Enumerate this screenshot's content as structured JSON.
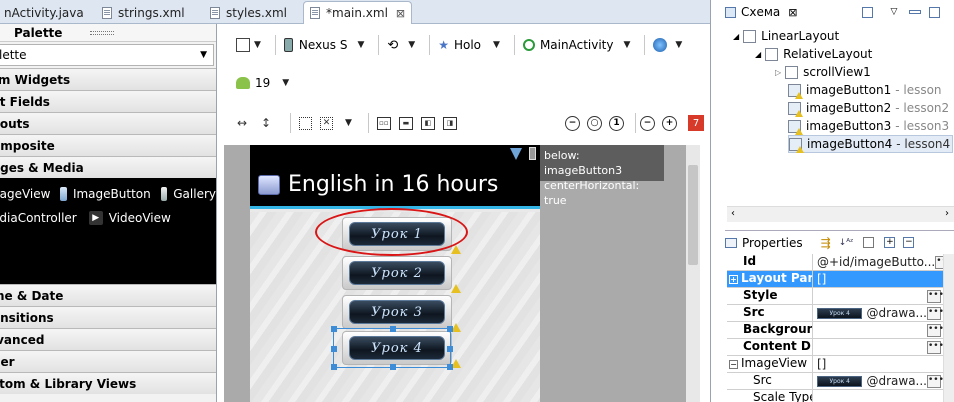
{
  "tabs": [
    {
      "label": "nActivity.java"
    },
    {
      "label": "strings.xml"
    },
    {
      "label": "styles.xml"
    },
    {
      "label": "*main.xml",
      "close": "⊠"
    }
  ],
  "palette": {
    "title": "Palette",
    "select_value": "lette",
    "categories": [
      "rm Widgets",
      "xt Fields",
      "youts",
      "omposite",
      "ages & Media",
      "me & Date",
      "ansitions",
      "lvanced",
      "her",
      "stom & Library Views"
    ],
    "media_widgets": [
      "nageView",
      "ImageButton",
      "Gallery",
      "ediaController",
      "VideoView"
    ]
  },
  "toolbar": {
    "device": "Nexus S",
    "theme": "Holo",
    "activity": "MainActivity",
    "api": "19",
    "error_count": "7"
  },
  "preview": {
    "app_title": "English in 16 hours",
    "buttons": [
      "Урок 1",
      "Урок 2",
      "Урок 3",
      "Урок 4"
    ],
    "tooltip_line1": "below: imageButton3",
    "tooltip_line2": "centerHorizontal: true"
  },
  "outline": {
    "title": "Схема",
    "items": [
      {
        "name": "LinearLayout",
        "extra": ""
      },
      {
        "name": "RelativeLayout",
        "extra": ""
      },
      {
        "name": "scrollView1",
        "extra": ""
      },
      {
        "name": "imageButton1",
        "extra": "- lesson"
      },
      {
        "name": "imageButton2",
        "extra": "- lesson2"
      },
      {
        "name": "imageButton3",
        "extra": "- lesson3"
      },
      {
        "name": "imageButton4",
        "extra": "- lesson4"
      }
    ]
  },
  "properties": {
    "title": "Properties",
    "rows": [
      {
        "key": "Id",
        "value": "@+id/imageButto..."
      },
      {
        "key": "Layout Par...",
        "value": "[]"
      },
      {
        "key": "Style",
        "value": ""
      },
      {
        "key": "Src",
        "value": "@drawa..."
      },
      {
        "key": "Background",
        "value": ""
      },
      {
        "key": "Content D...",
        "value": ""
      },
      {
        "key": "ImageView",
        "value": "[]"
      },
      {
        "key": "Src",
        "value": "@drawa..."
      },
      {
        "key": "Scale Type",
        "value": ""
      }
    ],
    "thumb_text": "Урок 4"
  }
}
